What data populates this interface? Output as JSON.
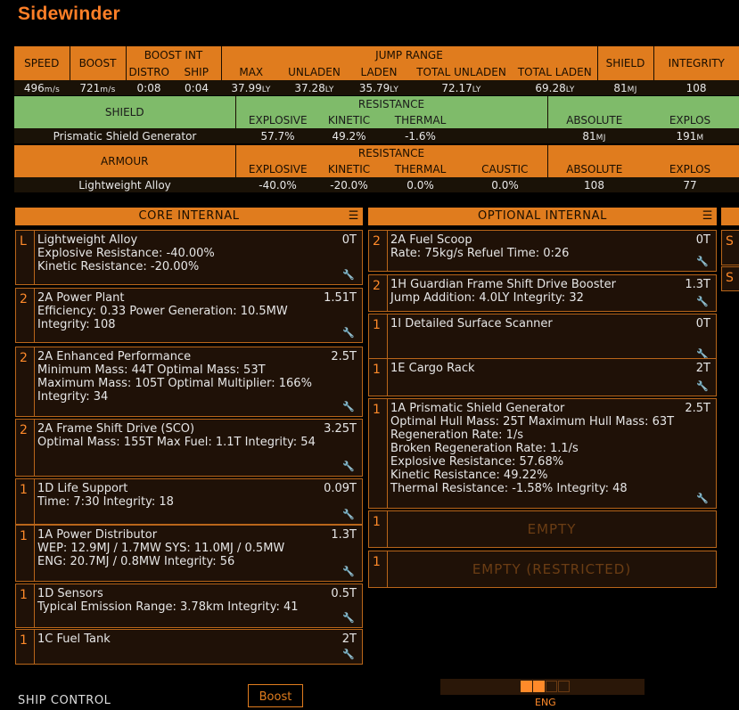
{
  "ship": {
    "name": "Sidewinder"
  },
  "stats": {
    "headers": {
      "speed": "SPEED",
      "boost": "BOOST",
      "boost_int": "BOOST INT",
      "distro": "DISTRO",
      "ship": "SHIP",
      "jump_range": "JUMP RANGE",
      "max": "MAX",
      "unladen": "UNLADEN",
      "laden": "LADEN",
      "total_unladen": "TOTAL UNLADEN",
      "total_laden": "TOTAL LADEN",
      "shield": "SHIELD",
      "integrity": "INTEGRITY"
    },
    "values": {
      "speed": "496",
      "speed_unit": "m/s",
      "boost": "721",
      "boost_unit": "m/s",
      "distro": "0:08",
      "ship": "0:04",
      "max": "37.99",
      "unladen": "37.28",
      "laden": "35.79",
      "total_unladen": "72.17",
      "total_laden": "69.28",
      "ly": "LY",
      "shield": "81",
      "shield_unit": "MJ",
      "integrity": "108"
    }
  },
  "shield_table": {
    "label": "SHIELD",
    "resistance": "RESISTANCE",
    "explosive": "EXPLOSIVE",
    "kinetic": "KINETIC",
    "thermal": "THERMAL",
    "absolute": "ABSOLUTE",
    "explosive2": "EXPLOS",
    "row": {
      "name": "Prismatic Shield Generator",
      "explosive": "57.7%",
      "kinetic": "49.2%",
      "thermal": "-1.6%",
      "absolute": "81",
      "absolute_unit": "MJ",
      "explosive2": "191",
      "explosive2_unit": "M"
    }
  },
  "armour_table": {
    "label": "ARMOUR",
    "resistance": "RESISTANCE",
    "explosive": "EXPLOSIVE",
    "kinetic": "KINETIC",
    "thermal": "THERMAL",
    "caustic": "CAUSTIC",
    "absolute": "ABSOLUTE",
    "explosive2": "EXPLOS",
    "row": {
      "name": "Lightweight Alloy",
      "explosive": "-40.0%",
      "kinetic": "-20.0%",
      "thermal": "0.0%",
      "caustic": "0.0%",
      "absolute": "108",
      "explosive2": "77"
    }
  },
  "core": {
    "title": "CORE INTERNAL",
    "slots": [
      {
        "size": "L",
        "name": "Lightweight Alloy",
        "mass": "0T",
        "lines": [
          "Explosive Resistance: -40.00%",
          "Kinetic Resistance: -20.00%"
        ]
      },
      {
        "size": "2",
        "name": "2A Power Plant",
        "mass": "1.51T",
        "lines": [
          "Efficiency: 0.33  Power Generation: 10.5MW",
          "Integrity: 108"
        ]
      },
      {
        "size": "2",
        "name": "2A Enhanced Performance",
        "mass": "2.5T",
        "lines": [
          "Minimum Mass: 44T  Optimal Mass: 53T",
          "Maximum Mass: 105T  Optimal Multiplier: 166%",
          "Integrity: 34"
        ]
      },
      {
        "size": "2",
        "name": "2A Frame Shift Drive (SCO)",
        "mass": "3.25T",
        "lines": [
          "Optimal Mass: 155T  Max Fuel: 1.1T  Integrity: 54"
        ]
      },
      {
        "size": "1",
        "name": "1D Life Support",
        "mass": "0.09T",
        "lines": [
          "Time: 7:30  Integrity: 18"
        ]
      },
      {
        "size": "1",
        "name": "1A Power Distributor",
        "mass": "1.3T",
        "lines": [
          "WEP: 12.9MJ / 1.7MW  SYS: 11.0MJ / 0.5MW",
          "ENG: 20.7MJ / 0.8MW  Integrity: 56"
        ]
      },
      {
        "size": "1",
        "name": "1D Sensors",
        "mass": "0.5T",
        "lines": [
          "Typical Emission Range: 3.78km  Integrity: 41"
        ]
      },
      {
        "size": "1",
        "name": "1C Fuel Tank",
        "mass": "2T",
        "lines": []
      }
    ]
  },
  "optional": {
    "title": "OPTIONAL INTERNAL",
    "slots": [
      {
        "size": "2",
        "name": "2A Fuel Scoop",
        "mass": "0T",
        "lines": [
          "Rate: 75kg/s  Refuel Time: 0:26"
        ]
      },
      {
        "size": "2",
        "name": "1H Guardian Frame Shift Drive Booster",
        "mass": "1.3T",
        "lines": [
          "Jump Addition: 4.0LY  Integrity: 32"
        ]
      },
      {
        "size": "1",
        "name": "1I Detailed Surface Scanner",
        "mass": "0T",
        "lines": []
      },
      {
        "size": "1",
        "name": "1E Cargo Rack",
        "mass": "2T",
        "lines": []
      },
      {
        "size": "1",
        "name": "1A Prismatic Shield Generator",
        "mass": "2.5T",
        "lines": [
          "Optimal Hull Mass: 25T  Maximum Hull Mass: 63T",
          "Regeneration Rate: 1/s",
          "Broken Regeneration Rate: 1.1/s",
          "Explosive Resistance: 57.68%",
          "Kinetic Resistance: 49.22%",
          "Thermal Resistance: -1.58%  Integrity: 48"
        ]
      },
      {
        "size": "1",
        "empty": "EMPTY"
      },
      {
        "size": "1",
        "empty": "EMPTY (RESTRICTED)"
      }
    ]
  },
  "footer": {
    "ship_control": "SHIP CONTROL",
    "boost_button": "Boost",
    "eng_label": "ENG"
  },
  "partial_s": "S"
}
